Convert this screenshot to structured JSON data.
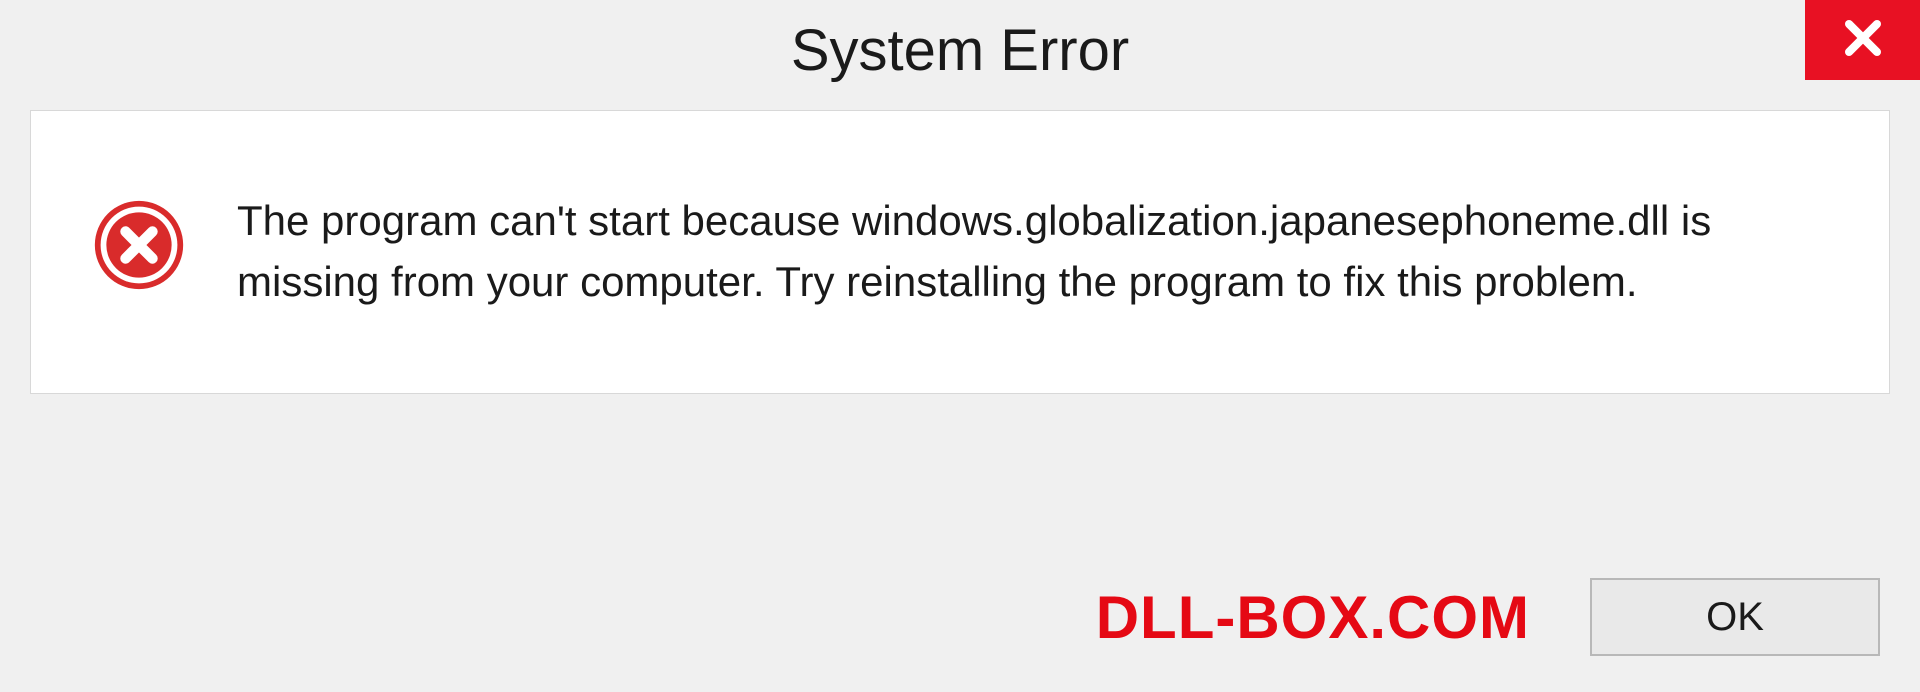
{
  "dialog": {
    "title": "System Error",
    "message": "The program can't start because windows.globalization.japanesephoneme.dll is missing from your computer. Try reinstalling the program to fix this problem.",
    "ok_label": "OK"
  },
  "watermark": "DLL-BOX.COM"
}
